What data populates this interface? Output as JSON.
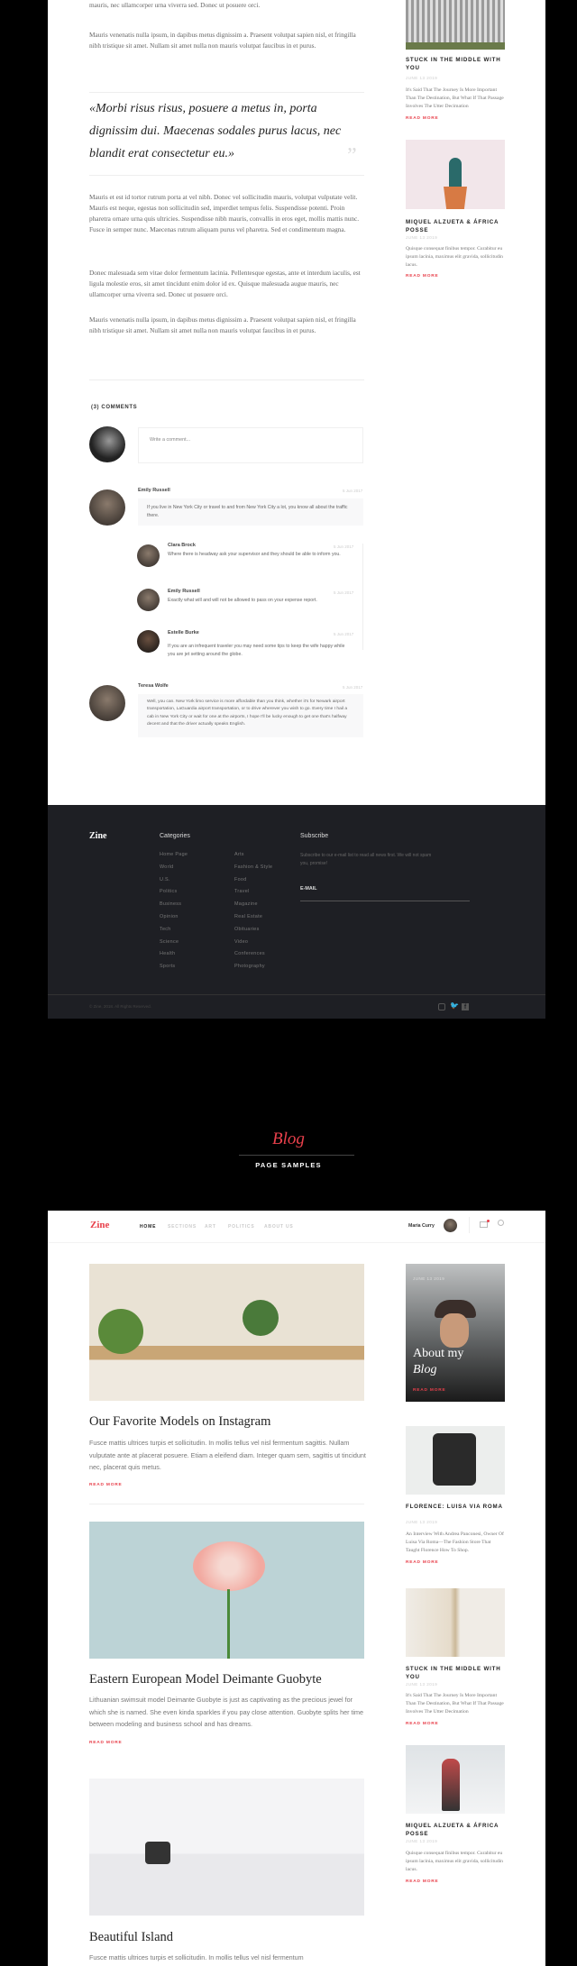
{
  "article": {
    "p0_tail": "mauris, nec ullamcorper urna viverra sed. Donec ut posuere orci.",
    "p1": "Mauris venenatis nulla ipsum, in dapibus metus dignissim a. Praesent volutpat sapien nisl, et fringilla nibh tristique sit amet. Nullam sit amet nulla non mauris volutpat faucibus in et purus.",
    "quote": "«Morbi risus risus, posuere a metus in, porta dignissim dui. Maecenas sodales purus lacus, nec blandit erat consectetur eu.»",
    "quote_mark": "”",
    "p2": "Mauris et est id tortor rutrum porta at vel nibh. Donec vel sollicitudin mauris, volutpat vulputate velit. Mauris est neque, egestas non sollicitudin sed, imperdiet tempus felis. Suspendisse potenti. Proin pharetra ornare urna quis ultricies. Suspendisse nibh mauris, convallis in eros eget, mollis mattis nunc. Fusce in semper nunc. Maecenas rutrum aliquam purus vel pharetra. Sed et condimentum magna.",
    "p3": "Donec malesuada sem vitae dolor fermentum lacinia. Pellentesque egestas, ante et interdum iaculis, est ligula molestie eros, sit amet tincidunt enim dolor id ex. Quisque malesuada augue mauris, nec ullamcorper urna viverra sed. Donec ut posuere orci.",
    "p4": "Mauris venenatis nulla ipsum, in dapibus metus dignissim a. Praesent volutpat sapien nisl, et fringilla nibh tristique sit amet. Nullam sit amet nulla non mauris volutpat faucibus in et purus."
  },
  "sidebar_top": [
    {
      "title": "STUCK IN THE MIDDLE WITH YOU",
      "date": "JUNE 13 2019",
      "text": "It's Said That The Journey Is More Important Than The Destination, But What If That Passage Involves The Utter Decimation",
      "read_more": "READ MORE"
    },
    {
      "title": "MIQUEL ALZUETA & ÁFRICA POSSE",
      "date": "JUNE 13 2019",
      "text": "Quisque consequat finibus tempor. Curabitur eu ipsum lacinia, maximus elit gravida, sollicitudin lacus.",
      "read_more": "READ MORE"
    }
  ],
  "comments": {
    "title": "(3) COMMENTS",
    "placeholder": "Write a comment...",
    "items": [
      {
        "name": "Emily Russell",
        "date": "5 Jun 2017",
        "text": "If you live in New York City or travel to and from New York City a lot, you know all about the traffic there."
      },
      {
        "name": "Clara Brock",
        "date": "5 Jun 2017",
        "text": "Where there is headway ask your supervisor and they should be able to inform you."
      },
      {
        "name": "Emily Russell",
        "date": "5 Jun 2017",
        "text": "Exactly what will and will not be allowed to pass on your expense report."
      },
      {
        "name": "Estelle Burke",
        "date": "5 Jun 2017",
        "text": "If you are an infrequent traveler you may need some tips to keep the wife happy while you are jet setting around the globe."
      },
      {
        "name": "Teresa Wolfe",
        "date": "5 Jun 2017",
        "text": "Well, you can. New York limo service is more affordable than you think, whether it's for Newark airport transportation, LaGuardia airport transportation, or to drive wherever you wish to go. Every time I hail a cab in New York City or wait for one at the airports, I hope I'll be lucky enough to get one that's halfway decent and that the driver actually speaks English."
      }
    ]
  },
  "footer": {
    "logo": "Zine",
    "categories_title": "Categories",
    "col1": [
      "Home Page",
      "World",
      "U.S.",
      "Politics",
      "Business",
      "Opinion",
      "Tech",
      "Science",
      "Health",
      "Sports"
    ],
    "col2": [
      "Arts",
      "Fashion & Style",
      "Food",
      "Travel",
      "Magazine",
      "Real Estate",
      "Obituaries",
      "Video",
      "Conferences",
      "Photography"
    ],
    "subscribe_title": "Subscribe",
    "subscribe_text": "Subscribe to our e-mail list to read all news first. We will not spam you, promise!",
    "email_label": "E-MAIL",
    "copyright": "© Zine, 2018. All Rights Reserved.",
    "social": [
      "instagram-icon",
      "twitter-icon",
      "facebook-icon"
    ]
  },
  "section": {
    "title": "Blog",
    "subtitle": "PAGE SAMPLES",
    "accent": "#e8404b"
  },
  "blog": {
    "logo": "Zine",
    "nav": [
      "HOME",
      "SECTIONS",
      "ART",
      "POLITICS",
      "ABOUT US"
    ],
    "user": "Maria Curry",
    "posts": [
      {
        "title": "Our Favorite Models on Instagram",
        "text": "Fusce mattis ultrices turpis et sollicitudin. In mollis tellus vel nisl fermentum sagittis. Nullam vulputate ante at placerat posuere. Etiam a eleifend diam. Integer quam sem, sagittis ut tincidunt nec, placerat quis metus.",
        "read_more": "READ MORE"
      },
      {
        "title": "Eastern European Model Deimante Guobyte",
        "text": "Lithuanian swimsuit model Deimante Guobyte is just as captivating as the precious jewel for which she is named. She even kinda sparkles if you pay close attention. Guobyte splits her time between modeling and business school and has dreams.",
        "read_more": "READ MORE"
      },
      {
        "title": "Beautiful Island",
        "text": "Fusce mattis ultrices turpis et sollicitudin. In mollis tellus vel nisl fermentum"
      }
    ],
    "about": {
      "date": "JUNE 13 2019",
      "title": "About my",
      "title_italic": "Blog",
      "read_more": "READ MORE"
    },
    "side": [
      {
        "title": "FLORENCE: LUISA VIA ROMA",
        "date": "JUNE 13 2019",
        "text": "An Interview With Andrea Panconesi, Owner Of Luisa Via Roma—The Fashion Store That Taught Florence How To Shop.",
        "read_more": "READ MORE"
      },
      {
        "title": "STUCK IN THE MIDDLE WITH YOU",
        "date": "JUNE 13 2019",
        "text": "It's Said That The Journey Is More Important Than The Destination, But What If That Passage Involves The Utter Decimation",
        "read_more": "READ MORE"
      },
      {
        "title": "MIQUEL ALZUETA & ÁFRICA POSSE",
        "date": "JUNE 13 2019",
        "text": "Quisque consequat finibus tempor. Curabitur eu ipsum lacinia, maximus elit gravida, sollicitudin lacus.",
        "read_more": "READ MORE"
      }
    ]
  }
}
